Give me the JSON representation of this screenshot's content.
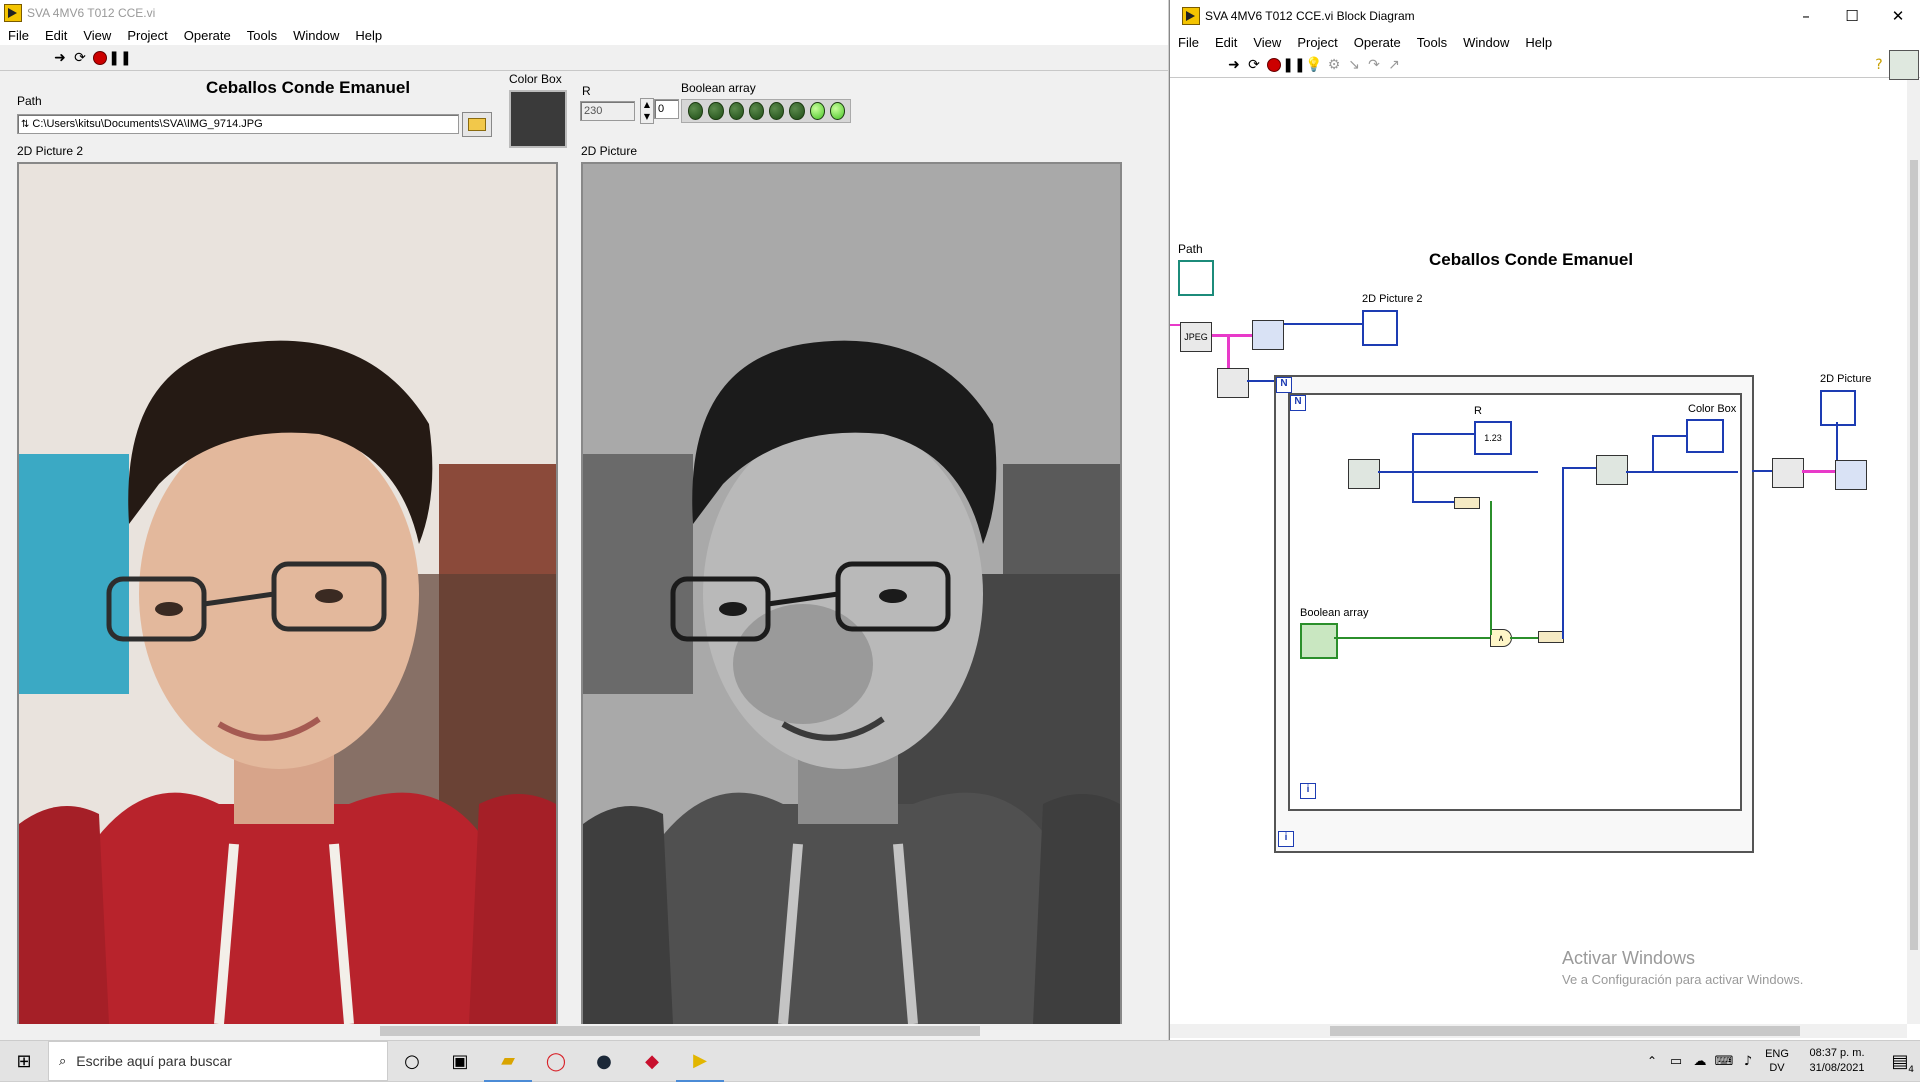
{
  "front_panel": {
    "window_title": "SVA 4MV6 T012 CCE.vi",
    "menu": [
      "File",
      "Edit",
      "View",
      "Project",
      "Operate",
      "Tools",
      "Window",
      "Help"
    ],
    "heading": "Ceballos Conde Emanuel",
    "path_label": "Path",
    "path_value": "C:\\Users\\kitsu\\Documents\\SVA\\IMG_9714.JPG",
    "color_box_label": "Color Box",
    "r_label": "R",
    "r_value": "230",
    "index_value": "0",
    "boolean_array_label": "Boolean array",
    "boolean_array_values": [
      false,
      false,
      false,
      false,
      false,
      false,
      true,
      true
    ],
    "picture2_label": "2D Picture 2",
    "picture_label": "2D Picture",
    "color_box_color": "#3a3a3a"
  },
  "block_diagram": {
    "window_title": "SVA 4MV6 T012 CCE.vi Block Diagram",
    "menu": [
      "File",
      "Edit",
      "View",
      "Project",
      "Operate",
      "Tools",
      "Window",
      "Help"
    ],
    "heading": "Ceballos Conde Emanuel",
    "labels": {
      "path": "Path",
      "picture2": "2D Picture 2",
      "picture": "2D Picture",
      "r": "R",
      "color_box": "Color Box",
      "boolean_array": "Boolean array",
      "jpeg": "JPEG",
      "n_outer": "N",
      "n_inner": "N",
      "i_outer": "i",
      "i_inner": "i",
      "num": "1.23"
    },
    "watermark_line1": "Activar Windows",
    "watermark_line2": "Ve a Configuración para activar Windows."
  },
  "taskbar": {
    "search_placeholder": "Escribe aquí para buscar",
    "lang_top": "ENG",
    "lang_bottom": "DV",
    "time": "08:37 p. m.",
    "date": "31/08/2021",
    "notifications": "4"
  }
}
